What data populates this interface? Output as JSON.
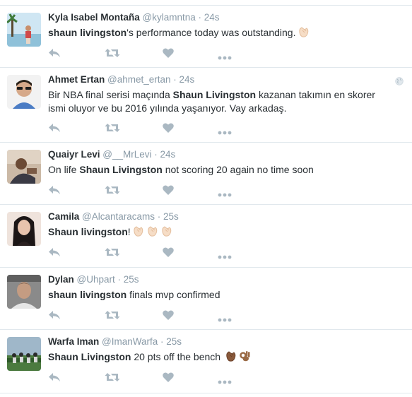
{
  "tweets": [
    {
      "name": "Kyla Isabel Montaña",
      "handle": "@kylamntna",
      "sep": "·",
      "time": "24s",
      "segments": [
        {
          "bold": "shaun livingston"
        },
        {
          "text": "'s performance today was outstanding."
        }
      ],
      "emojis": [
        "clapping-hands"
      ]
    },
    {
      "name": "Ahmet Ertan",
      "handle": "@ahmet_ertan",
      "sep": "·",
      "time": "24s",
      "has_globe": true,
      "segments": [
        {
          "text": "Bir NBA final serisi maçında "
        },
        {
          "bold": "Shaun Livingston"
        },
        {
          "text": " kazanan takımın en skorer ismi oluyor ve bu 2016 yılında yaşanıyor. Vay arkadaş."
        }
      ],
      "emojis": []
    },
    {
      "name": "Quaiyr Levi",
      "handle": "@__MrLevi",
      "sep": "·",
      "time": "24s",
      "segments": [
        {
          "text": "On life "
        },
        {
          "bold": "Shaun Livingston"
        },
        {
          "text": " not scoring 20 again no time soon"
        }
      ],
      "emojis": []
    },
    {
      "name": "Camila",
      "handle": "@Alcantaracams",
      "sep": "·",
      "time": "25s",
      "segments": [
        {
          "bold": "Shaun livingston"
        },
        {
          "text": "!"
        }
      ],
      "emojis": [
        "clapping-hands",
        "clapping-hands",
        "clapping-hands"
      ]
    },
    {
      "name": "Dylan",
      "handle": "@Uhpart",
      "sep": "·",
      "time": "25s",
      "segments": [
        {
          "bold": "shaun livingston"
        },
        {
          "text": " finals mvp confirmed"
        }
      ],
      "emojis": []
    },
    {
      "name": "Warfa Iman",
      "handle": "@ImanWarfa",
      "sep": "·",
      "time": "25s",
      "segments": [
        {
          "bold": "Shaun Livingston"
        },
        {
          "text": " 20 pts off the bench "
        }
      ],
      "emojis": [
        "clapping-hands-dark",
        "ok-hand-dark"
      ]
    }
  ],
  "actions": [
    "reply-icon",
    "retweet-icon",
    "like-icon",
    "more-icon"
  ],
  "colors": {
    "action_gray": "#aab8c2",
    "meta_gray": "#8899a6",
    "text": "#292f33",
    "divider": "#e1e8ed"
  }
}
